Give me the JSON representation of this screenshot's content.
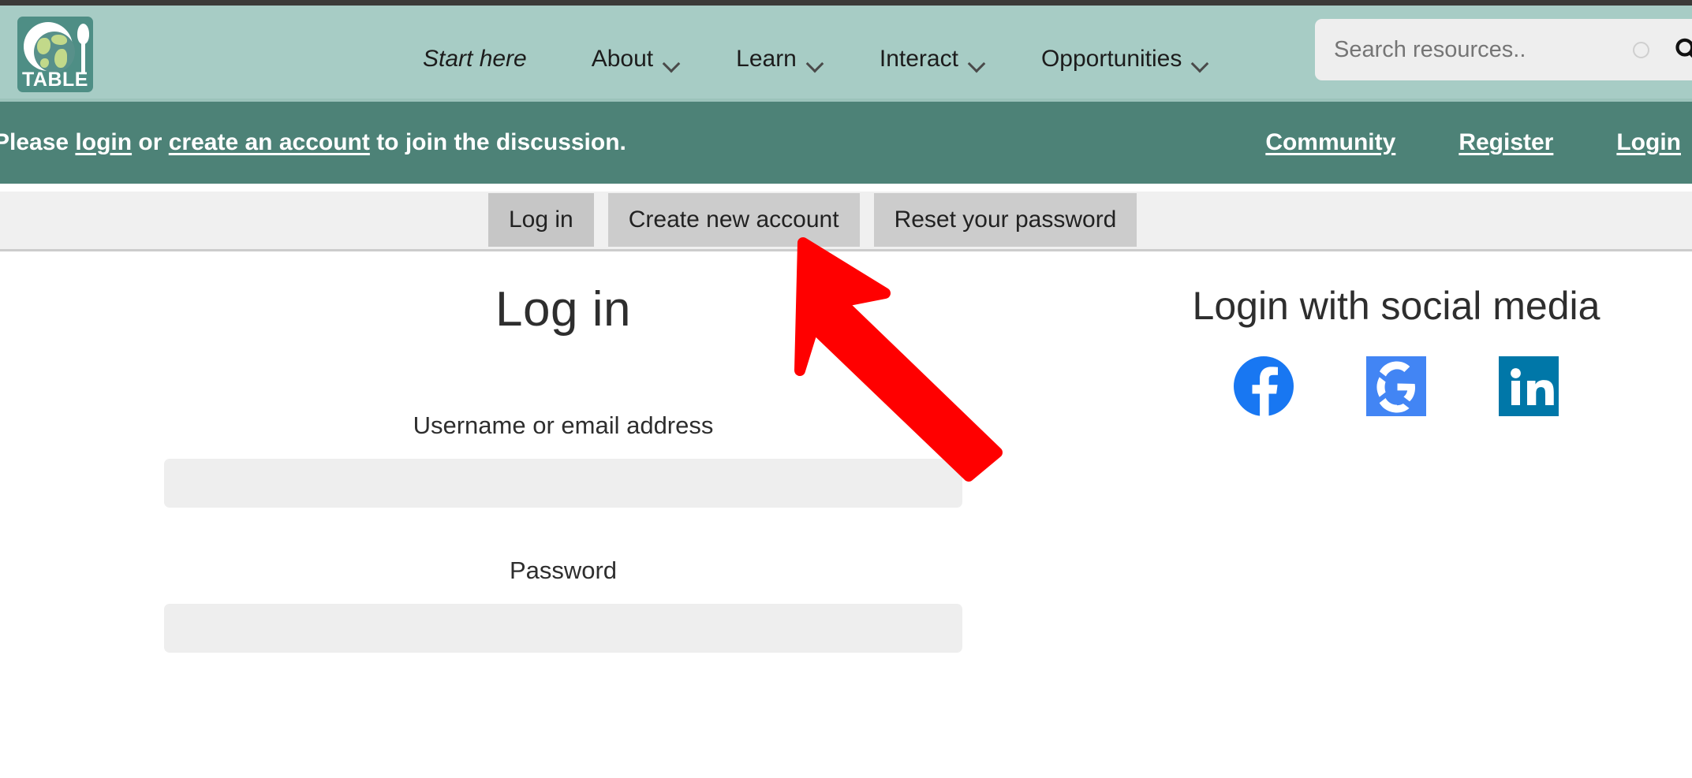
{
  "site": {
    "logo_word": "TABLE",
    "logo_alt": "TABLE globe and spoon logo"
  },
  "header": {
    "nav": [
      {
        "label": "Start here",
        "has_dropdown": false,
        "italic": true
      },
      {
        "label": "About",
        "has_dropdown": true,
        "italic": false
      },
      {
        "label": "Learn",
        "has_dropdown": true,
        "italic": false
      },
      {
        "label": "Interact",
        "has_dropdown": true,
        "italic": false
      },
      {
        "label": "Opportunities",
        "has_dropdown": true,
        "italic": false
      }
    ],
    "search": {
      "placeholder": "Search resources..",
      "value": "",
      "spinner_icon": "circle-spinner-icon",
      "submit_icon": "search-icon"
    }
  },
  "notice": {
    "prefix": "Please ",
    "login_link": "login",
    "middle": " or ",
    "create_link": "create an account",
    "suffix": " to join the discussion.",
    "links": [
      {
        "label": "Community"
      },
      {
        "label": "Register"
      },
      {
        "label": "Login"
      }
    ]
  },
  "tabs": [
    {
      "label": "Log in",
      "active": true
    },
    {
      "label": "Create new account",
      "active": false
    },
    {
      "label": "Reset your password",
      "active": false
    }
  ],
  "login_form": {
    "title": "Log in",
    "username_label": "Username or email address",
    "username_value": "",
    "username_placeholder": "",
    "password_label": "Password",
    "password_value": "",
    "password_placeholder": ""
  },
  "social": {
    "title": "Login with social media",
    "providers": [
      {
        "name": "facebook",
        "icon": "facebook-icon",
        "color": "#1877F2"
      },
      {
        "name": "google",
        "icon": "google-icon",
        "color": "#4285F4"
      },
      {
        "name": "linkedin",
        "icon": "linkedin-icon",
        "color": "#0077A8"
      }
    ]
  },
  "annotation": {
    "arrow_color": "#FF0000",
    "points_to": "Create new account"
  },
  "colors": {
    "header_bg": "#A7CCC5",
    "notice_bg": "#4D8277",
    "tabstrip_bg": "#F0F0F0",
    "tab_bg": "#CCCCCC",
    "input_bg": "#EEEEEE",
    "logo_bg": "#4E8E85"
  }
}
